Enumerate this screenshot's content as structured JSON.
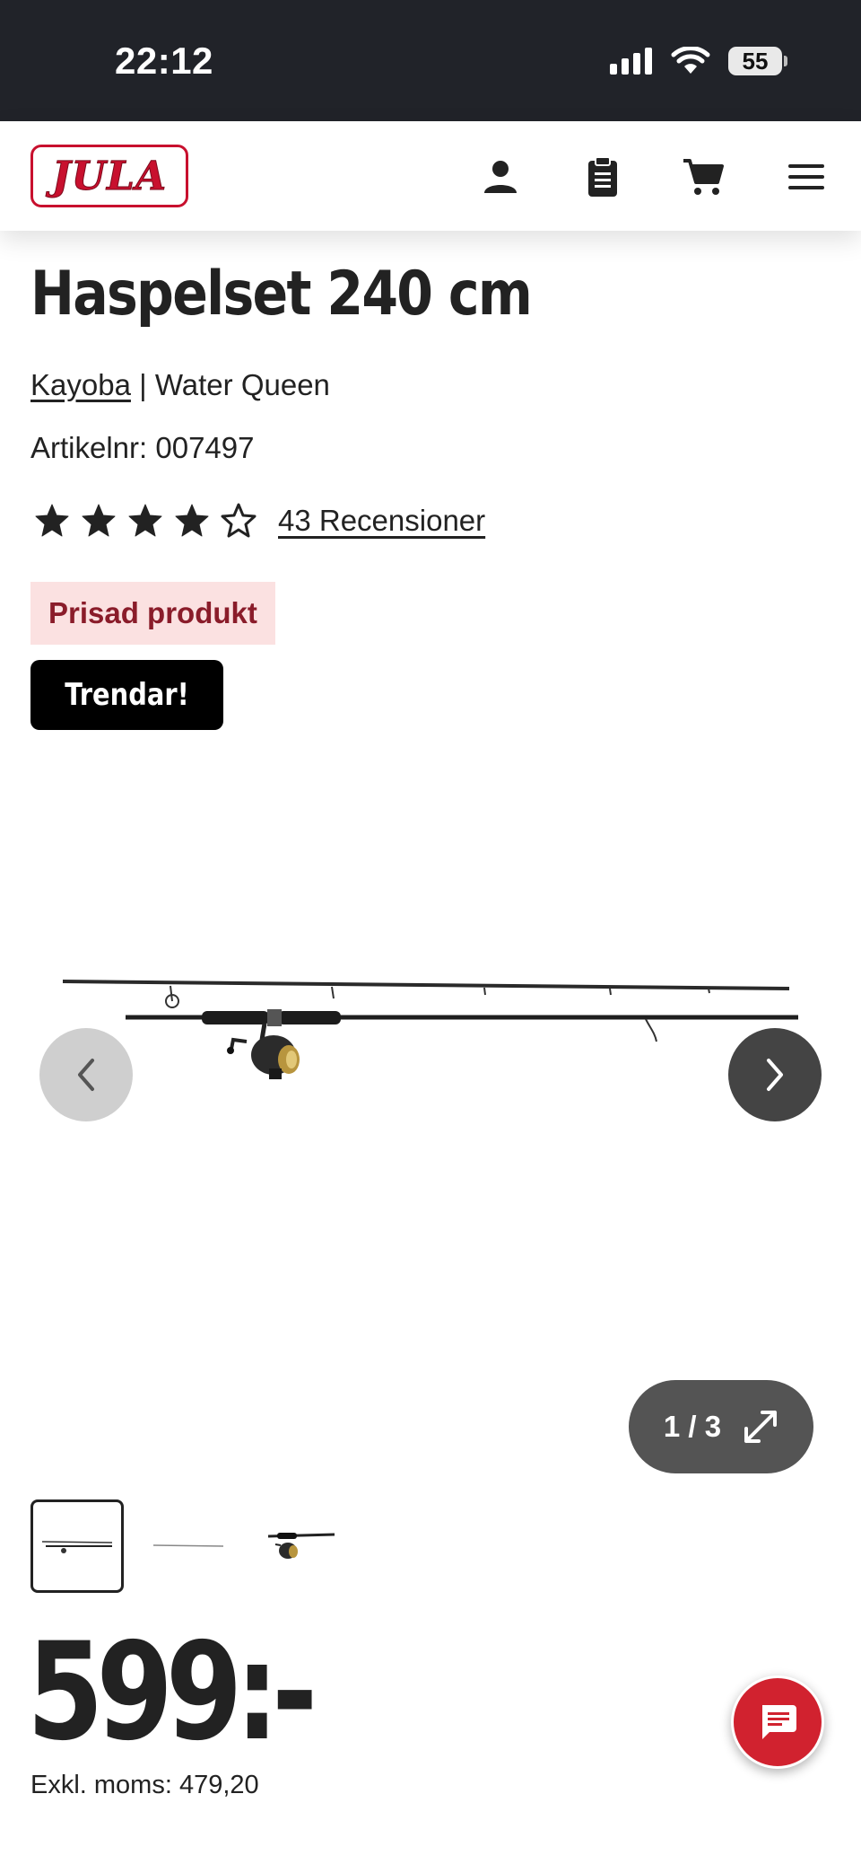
{
  "status_bar": {
    "time": "22:12",
    "battery": "55"
  },
  "header": {
    "logo_text": "JULA",
    "icons": [
      "account-icon",
      "clipboard-icon",
      "cart-icon",
      "menu-icon"
    ]
  },
  "product": {
    "title": "Haspelset 240 cm",
    "brand": "Kayoba",
    "brand_separator": " | ",
    "series": "Water Queen",
    "article_number": "Artikelnr: 007497",
    "rating": {
      "value": 4,
      "max": 5
    },
    "reviews_link": "43 Recensioner",
    "badge_award": "Prisad produkt",
    "badge_trend": "Trendar!"
  },
  "gallery": {
    "counter": "1 / 3",
    "total_images": 3,
    "active_index": 1
  },
  "pricing": {
    "price": "599:-",
    "excl_vat": "Exkl. moms: 479,20"
  },
  "colors": {
    "brand_red": "#c8102e",
    "award_bg": "#fbe1e1",
    "award_text": "#8a1c2a",
    "status_bg": "#212329",
    "chat_red": "#d1222f"
  }
}
